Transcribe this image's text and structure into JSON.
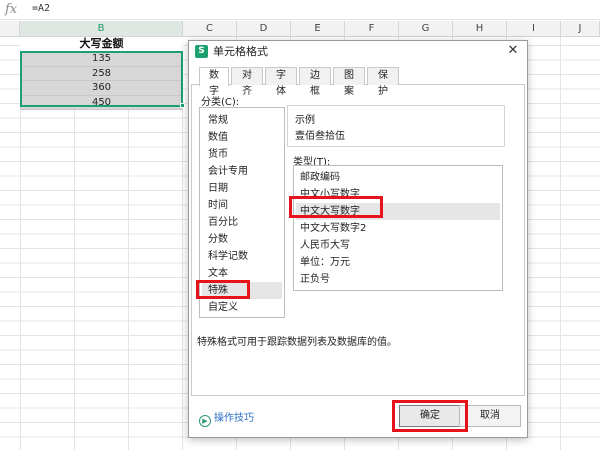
{
  "formula_bar": {
    "fx_label": "fx",
    "formula": "=A2"
  },
  "columns": [
    "B",
    "C",
    "D",
    "E",
    "F",
    "G",
    "H",
    "I",
    "J"
  ],
  "sheet": {
    "header_cell": "大写金额",
    "values": [
      "135",
      "258",
      "360",
      "450"
    ]
  },
  "dialog": {
    "icon_text": "S",
    "title": "单元格格式",
    "close_glyph": "✕",
    "tabs": [
      "数字",
      "对齐",
      "字体",
      "边框",
      "图案",
      "保护"
    ],
    "active_tab": "数字",
    "category_label": "分类(C):",
    "categories": [
      "常规",
      "数值",
      "货币",
      "会计专用",
      "日期",
      "时间",
      "百分比",
      "分数",
      "科学记数",
      "文本",
      "特殊",
      "自定义"
    ],
    "selected_category": "特殊",
    "sample_label": "示例",
    "sample_value": "壹佰叁拾伍",
    "type_label": "类型(T):",
    "types": [
      "邮政编码",
      "中文小写数字",
      "中文大写数字",
      "中文大写数字2",
      "人民币大写",
      "单位：万元",
      "正负号"
    ],
    "selected_type": "中文大写数字",
    "description": "特殊格式可用于跟踪数据列表及数据库的值。",
    "tips_label": "操作技巧",
    "ok_label": "确定",
    "cancel_label": "取消"
  },
  "colors": {
    "accent": "#1ba06f",
    "highlight": "#e8131a",
    "link": "#2b6fc6"
  }
}
